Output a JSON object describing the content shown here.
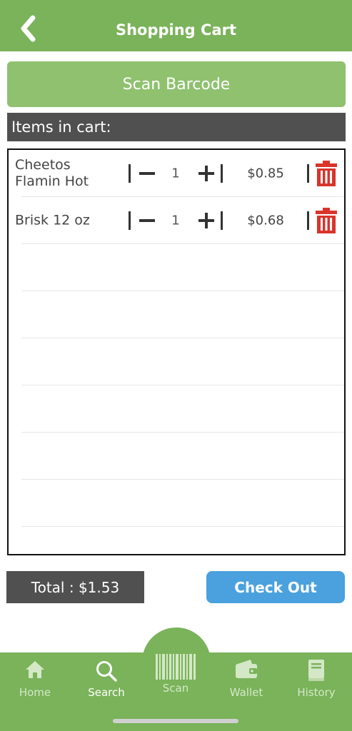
{
  "header": {
    "title": "Shopping Cart",
    "back_icon": "chevron-left-icon"
  },
  "scan_button": {
    "label": "Scan Barcode"
  },
  "cart": {
    "section_title": "Items in cart:",
    "items": [
      {
        "name_line1": "Cheetos",
        "name_line2": "Flamin Hot",
        "quantity": "1",
        "price": "$0.85"
      },
      {
        "name_line1": "Brisk 12 oz",
        "name_line2": "",
        "quantity": "1",
        "price": "$0.68"
      }
    ]
  },
  "footer": {
    "total_label": "Total : $1.53",
    "checkout_label": "Check Out"
  },
  "tabs": [
    {
      "label": "Home",
      "icon": "home-icon",
      "active": false
    },
    {
      "label": "Search",
      "icon": "search-icon",
      "active": true
    },
    {
      "label": "Scan",
      "icon": "barcode-icon",
      "active": false
    },
    {
      "label": "Wallet",
      "icon": "wallet-icon",
      "active": false
    },
    {
      "label": "History",
      "icon": "book-icon",
      "active": false
    }
  ],
  "colors": {
    "brand_green": "#7ab35a",
    "scan_button_green": "#8fc16f",
    "dark_gray": "#505050",
    "checkout_blue": "#4aa1dd",
    "delete_red": "#d9342b"
  }
}
